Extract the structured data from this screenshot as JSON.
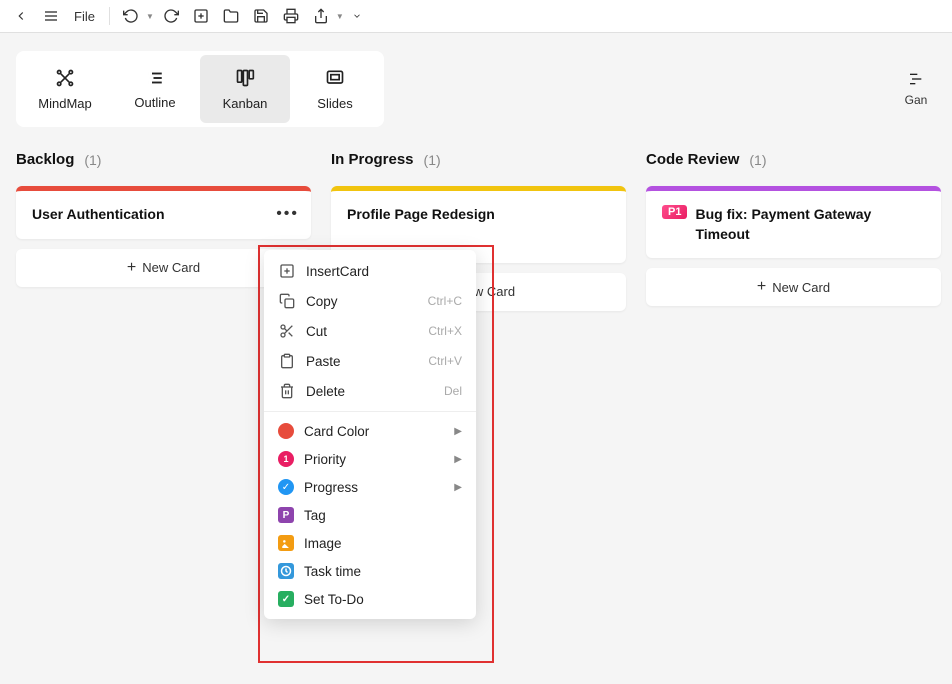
{
  "toolbar": {
    "file_label": "File"
  },
  "views": {
    "mindmap": "MindMap",
    "outline": "Outline",
    "kanban": "Kanban",
    "slides": "Slides",
    "gantt": "Gan"
  },
  "columns": [
    {
      "title": "Backlog",
      "count": "(1)",
      "cards": [
        {
          "title": "User Authentication",
          "color": "red"
        }
      ]
    },
    {
      "title": "In Progress",
      "count": "(1)",
      "cards": [
        {
          "title": "Profile Page Redesign",
          "color": "yellow"
        }
      ]
    },
    {
      "title": "Code Review",
      "count": "(1)",
      "cards": [
        {
          "title": "Bug fix: Payment Gateway Timeout",
          "color": "purple",
          "priority": "P1"
        }
      ]
    }
  ],
  "new_card_label": "New Card",
  "context_menu": {
    "insert_card": "InsertCard",
    "copy": "Copy",
    "copy_shortcut": "Ctrl+C",
    "cut": "Cut",
    "cut_shortcut": "Ctrl+X",
    "paste": "Paste",
    "paste_shortcut": "Ctrl+V",
    "delete": "Delete",
    "delete_shortcut": "Del",
    "card_color": "Card Color",
    "priority": "Priority",
    "progress": "Progress",
    "tag": "Tag",
    "image": "Image",
    "task_time": "Task time",
    "set_todo": "Set To-Do"
  }
}
